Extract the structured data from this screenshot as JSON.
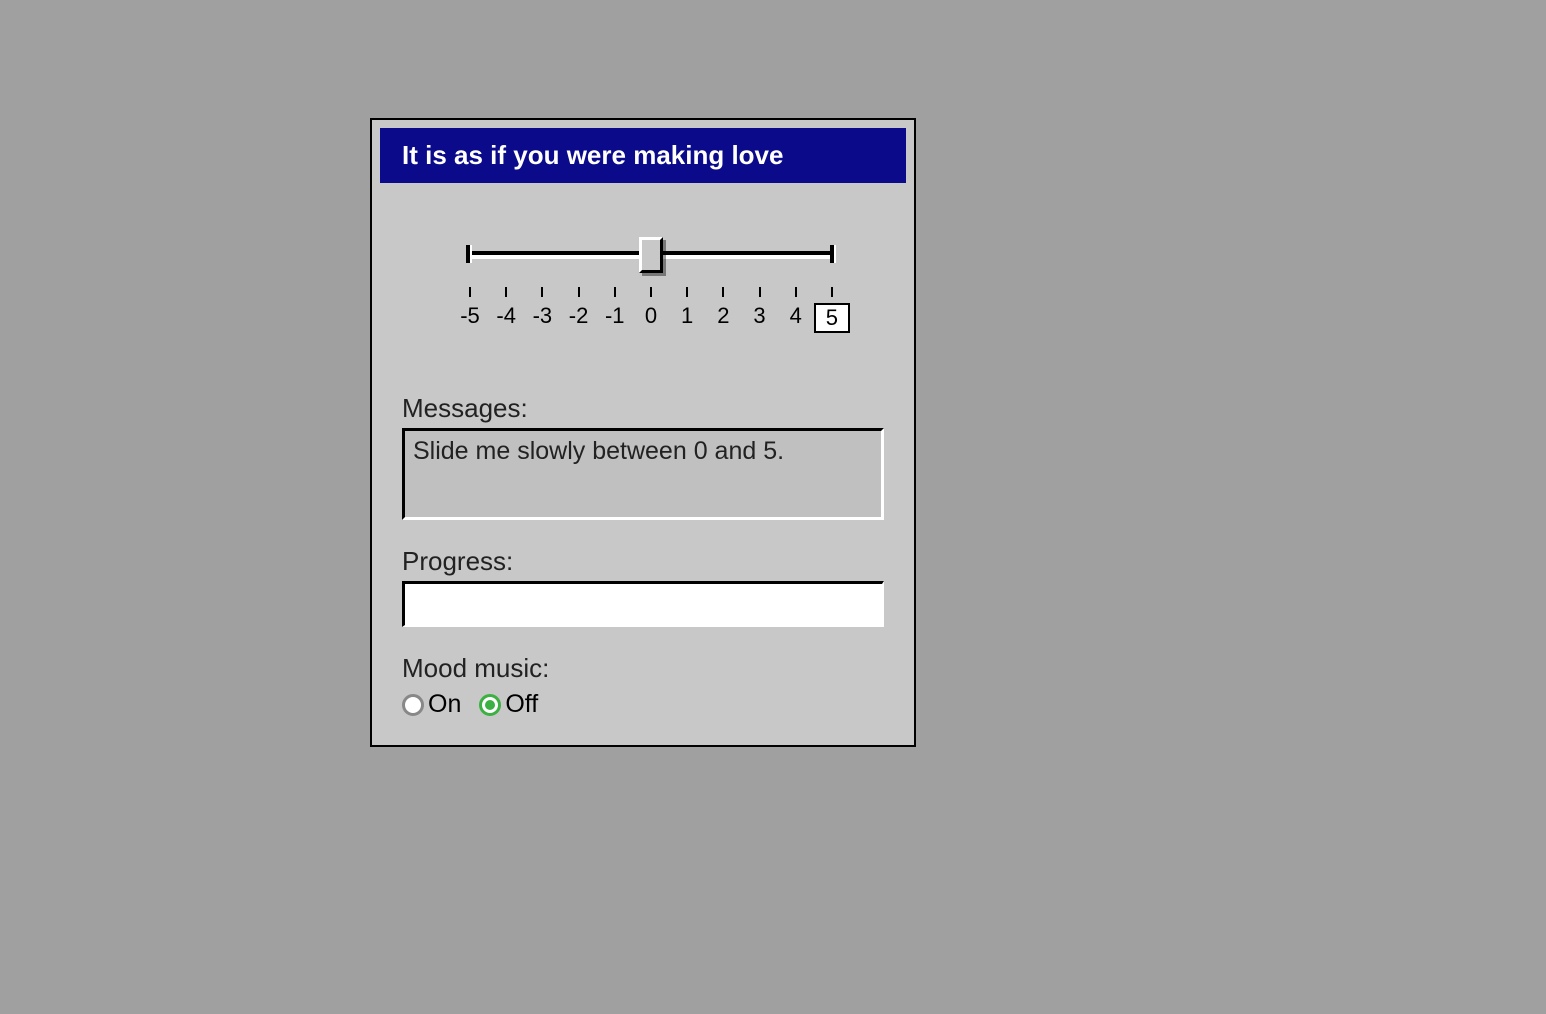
{
  "title": "It is as if you were making love",
  "slider": {
    "min": -5,
    "max": 5,
    "value": 0,
    "target": 5,
    "ticks": [
      "-5",
      "-4",
      "-3",
      "-2",
      "-1",
      "0",
      "1",
      "2",
      "3",
      "4",
      "5"
    ]
  },
  "messages": {
    "label": "Messages:",
    "text": "Slide me slowly between 0 and 5."
  },
  "progress": {
    "label": "Progress:",
    "percent": 0
  },
  "mood": {
    "label": "Mood music:",
    "options": {
      "on": "On",
      "off": "Off"
    },
    "selected": "off"
  }
}
